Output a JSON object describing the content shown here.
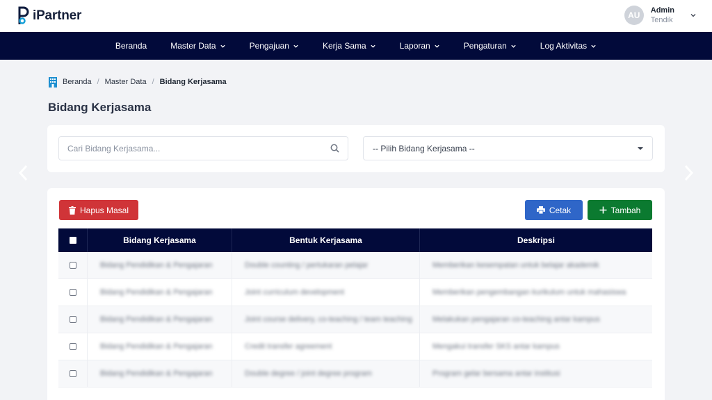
{
  "header": {
    "brand": "iPartner",
    "user": {
      "initials": "AU",
      "name": "Admin",
      "role": "Tendik"
    }
  },
  "nav": [
    {
      "label": "Beranda",
      "dropdown": false
    },
    {
      "label": "Master Data",
      "dropdown": true
    },
    {
      "label": "Pengajuan",
      "dropdown": true
    },
    {
      "label": "Kerja Sama",
      "dropdown": true
    },
    {
      "label": "Laporan",
      "dropdown": true
    },
    {
      "label": "Pengaturan",
      "dropdown": true
    },
    {
      "label": "Log Aktivitas",
      "dropdown": true
    }
  ],
  "breadcrumb": {
    "items": [
      "Beranda",
      "Master Data"
    ],
    "current": "Bidang Kerjasama"
  },
  "page": {
    "title": "Bidang Kerjasama"
  },
  "filter": {
    "search_placeholder": "Cari Bidang Kerjasama...",
    "select_value": "-- Pilih Bidang Kerjasama --"
  },
  "toolbar": {
    "delete_label": "Hapus Masal",
    "print_label": "Cetak",
    "add_label": "Tambah"
  },
  "table": {
    "headers": [
      "Bidang Kerjasama",
      "Bentuk Kerjasama",
      "Deskripsi"
    ],
    "rows": [
      [
        "Bidang Pendidikan & Pengajaran",
        "Double counting / pertukaran pelajar",
        "Memberikan kesempatan untuk belajar akademik"
      ],
      [
        "Bidang Pendidikan & Pengajaran",
        "Joint curriculum development",
        "Memberikan pengembangan kurikulum untuk mahasiswa"
      ],
      [
        "Bidang Pendidikan & Pengajaran",
        "Joint course delivery, co-teaching / team teaching",
        "Melakukan pengajaran co-teaching antar kampus"
      ],
      [
        "Bidang Pendidikan & Pengajaran",
        "Credit transfer agreement",
        "Mengakui transfer SKS antar kampus"
      ],
      [
        "Bidang Pendidikan & Pengajaran",
        "Double degree / joint degree program",
        "Program gelar bersama antar institusi"
      ]
    ]
  },
  "colors": {
    "navy": "#020a3a",
    "danger": "#d03438",
    "primary": "#2f66c8",
    "success": "#0b7a30"
  }
}
